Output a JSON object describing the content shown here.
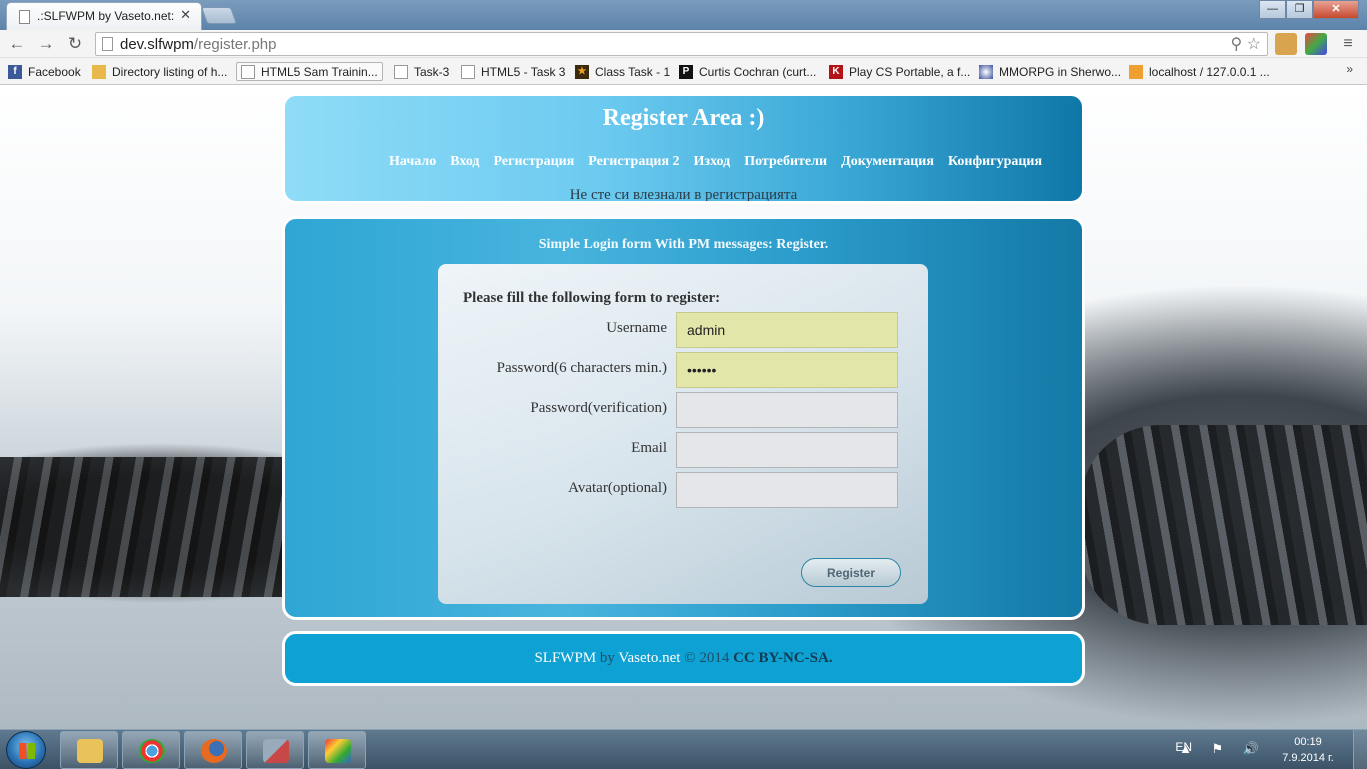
{
  "browser": {
    "tab_title": ".:SLFWPM by Vaseto.net:.",
    "tab_close": "✕",
    "url_host": "dev.slfwpm",
    "url_path": "/register.php",
    "window_minimize": "—",
    "window_maximize": "❐",
    "window_close": "✕",
    "back": "←",
    "forward": "→",
    "reload": "↻",
    "omni_icons": "⚲ ☆",
    "bookmarks": [
      {
        "label": "Facebook",
        "icon": "f",
        "color": "#3b5998"
      },
      {
        "label": "Directory listing of h...",
        "icon": "",
        "color": "#e8b84a"
      },
      {
        "label": "HTML5 Sam Trainin...",
        "icon": "",
        "color": "#ffffff"
      },
      {
        "label": "Task-3",
        "icon": "",
        "color": "#ffffff"
      },
      {
        "label": "HTML5 - Task 3",
        "icon": "",
        "color": "#ffffff"
      },
      {
        "label": "Class Task - 1",
        "icon": "★",
        "color": "#3a2a10"
      },
      {
        "label": "Curtis Cochran (curt...",
        "icon": "P",
        "color": "#111111"
      },
      {
        "label": "Play CS Portable, a f...",
        "icon": "K",
        "color": "#b31217"
      },
      {
        "label": "MMORPG in Sherwo...",
        "icon": "",
        "color": "#3b4fa0"
      },
      {
        "label": "localhost / 127.0.0.1 ...",
        "icon": "",
        "color": "#f0a030"
      }
    ],
    "bookmarks_more": "»"
  },
  "page": {
    "header": {
      "title": "Register Area :)",
      "nav": [
        "Начало",
        "Вход",
        "Регистрация",
        "Регистрация 2",
        "Изход",
        "Потребители",
        "Документация",
        "Конфигурация"
      ],
      "login_status": "Не сте си влезнали в регистрацията"
    },
    "main": {
      "title": "Simple Login form With PM messages: Register.",
      "form": {
        "heading": "Please fill the following form to register:",
        "fields": [
          {
            "label": "Username",
            "value": "admin",
            "type": "text"
          },
          {
            "label": "Password(6 characters min.)",
            "value": "••••••",
            "type": "password"
          },
          {
            "label": "Password(verification)",
            "value": "",
            "type": "password"
          },
          {
            "label": "Email",
            "value": "",
            "type": "text"
          },
          {
            "label": "Avatar(optional)",
            "value": "",
            "type": "text"
          }
        ],
        "submit_label": "Register"
      }
    },
    "footer": {
      "site": "SLFWPM",
      "by": "by",
      "author": "Vaseto.net",
      "copyright": "© 2014",
      "license": "CC BY-NC-SA."
    }
  },
  "taskbar": {
    "language": "EN",
    "tray_icons": "▲ ⚑ 🔊",
    "time": "00:19",
    "date": "7.9.2014 г.",
    "apps": [
      {
        "name": "explorer",
        "color": "#e9c25a"
      },
      {
        "name": "chrome",
        "color": "#4aa3df"
      },
      {
        "name": "firefox",
        "color": "#e66a1f"
      },
      {
        "name": "app-4",
        "color": "#c84848"
      },
      {
        "name": "paint",
        "color": "#9fc0d8"
      }
    ]
  }
}
